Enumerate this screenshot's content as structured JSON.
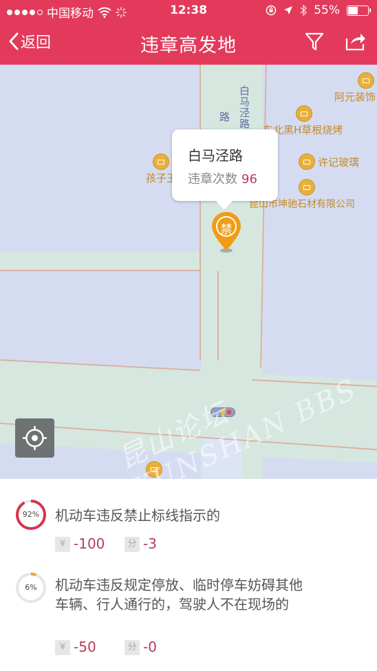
{
  "status": {
    "carrier": "中国移动",
    "time": "12:38",
    "battery": "55%",
    "battery_level": 0.55
  },
  "nav": {
    "back_label": "返回",
    "title": "违章高发地"
  },
  "map": {
    "road_label_main": "白马泾路",
    "road_label_partial": "路",
    "pois": {
      "ayuan": "阿元装饰",
      "dongbei": "东北黑H草根烧烤",
      "xuji": "许记玻璃",
      "kunshan": "昆山市坤驰石材有限公司",
      "haizi": "孩子王"
    },
    "callout": {
      "name": "白马泾路",
      "count_label": "违章次数",
      "count": "96"
    },
    "pin_label": "禁",
    "watermark": "昆山论坛 KUNSHAN BBS"
  },
  "violations": [
    {
      "percent": "92%",
      "percent_value": 0.92,
      "description": "机动车违反禁止标线指示的",
      "fine_icon": "¥",
      "fine": "-100",
      "points_icon": "分",
      "points": "-3"
    },
    {
      "percent": "6%",
      "percent_value": 0.06,
      "description": "机动车违反规定停放、临时停车妨碍其他车辆、行人通行的，驾驶人不在现场的",
      "fine_icon": "¥",
      "fine": "-50",
      "points_icon": "分",
      "points": "-0"
    }
  ],
  "colors": {
    "brand": "#e33a5c",
    "value": "#b63c5d",
    "ring_high": "#d8334f",
    "ring_low": "#f0a030"
  }
}
